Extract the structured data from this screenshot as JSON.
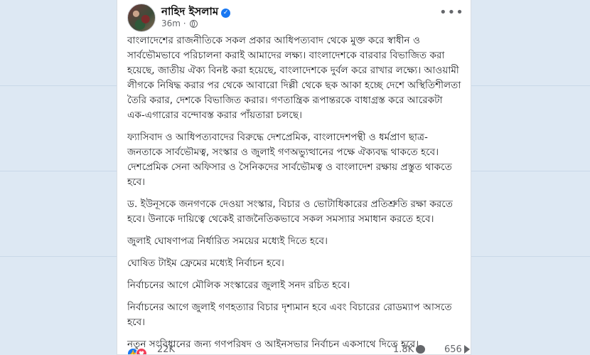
{
  "post": {
    "author": "নাহিদ ইসলাম",
    "time": "36m",
    "time_separator": "·",
    "more_label": "•••",
    "paragraphs": [
      "বাংলাদেশের রাজনীতিকে সকল প্রকার আধিপত্যবাদ থেকে মুক্ত করে স্বাধীন ও সার্বভৌমভাবে পরিচালনা করাই আমাদের লক্ষ্য। বাংলাদেশকে বারবার বিভাজিত করা হয়েছে, জাতীয় ঐক্য বিনষ্ট করা হয়েছে, বাংলাদেশকে দুর্বল করে রাখার লক্ষ্যে। আওয়ামী লীগকে নিষিদ্ধ করার পর থেকে আবারো দিল্লী থেকে ছক আকা হচ্ছে দেশে অস্থিতিশীলতা তৈরি করার, দেশকে বিভাজিত করার। গণতান্ত্রিক রূপান্তরকে বাধাগ্রস্ত করে আরেকটা এক-এগারোর বন্দোবস্ত করার পাঁয়তারা চলছে।",
      "ফ্যাসিবাদ ও আধিপত্যবাদের বিরুদ্ধে দেশপ্রেমিক, বাংলাদেশপন্থী ও ধর্মপ্রাণ ছাত্র-জনতাকে সার্বভৌমত্ব, সংস্কার ও জুলাই গণঅভ্যুত্থানের পক্ষে ঐক্যবদ্ধ থাকতে হবে। দেশপ্রেমিক সেনা অফিসার ও সৈনিকদের সার্বভৌমত্ব ও বাংলাদেশ রক্ষায় প্রস্তুত থাকতে হবে।",
      "ড. ইউনূসকে জনগণকে দেওয়া সংস্কার, বিচার ও ভোটাধিকারের প্রতিশ্রুতি রক্ষা করতে হবে। উনাকে দায়িত্বে থেকেই রাজনৈতিকভাবে সকল সমস্যার সমাধান করতে হবে।",
      "জুলাই ঘোষণাপত্র নির্ধারিত সময়ের মধ্যেই দিতে হবে।",
      "ঘোষিত টাইম ফ্রেমের মধ্যেই নির্বাচন হবে।",
      "নির্বাচনের আগে মৌলিক সংস্কারের জুলাই সনদ রচিত হবে।",
      "নির্বাচনের আগে জুলাই গণহত্যার বিচার দৃশ্যমান হবে এবং বিচারের রোডম্যাপ আসতে হবে।",
      "নতুন সংবিধানের জন্য গণপরিষদ ও আইনসভার নির্বাচন একসাথে দিতে হবে।"
    ],
    "reactions_count": "22K",
    "comments_count": "1.8K",
    "shares_count": "656",
    "reaction_icons": [
      "like-icon",
      "love-icon"
    ],
    "verified_icon": "verified-badge-icon",
    "privacy_icon": "globe-icon"
  },
  "colors": {
    "background": "#dde8f3",
    "card": "#ffffff",
    "text": "#1c1e21",
    "muted": "#65676b",
    "like_blue": "#1877f2",
    "love_red": "#f33e58"
  }
}
